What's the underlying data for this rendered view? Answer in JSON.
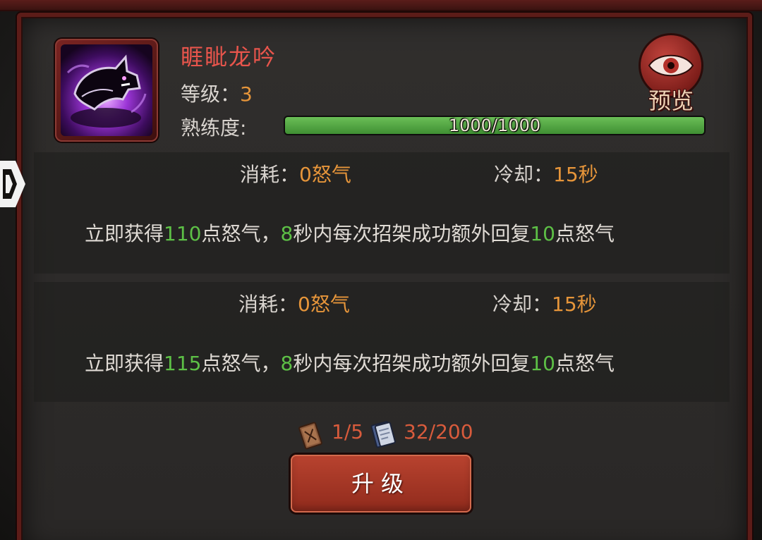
{
  "skill": {
    "name": "睚眦龙吟",
    "level_label": "等级：",
    "level_value": "3",
    "mastery_label": "熟练度:",
    "mastery_text": "1000/1000",
    "mastery_fraction": 1.0,
    "icon": "wolf-skill-icon"
  },
  "preview": {
    "label": "预览",
    "icon": "eye-icon"
  },
  "tiers": [
    {
      "cost_label": "消耗：",
      "cost_value": "0怒气",
      "cooldown_label": "冷却：",
      "cooldown_value": "15秒",
      "desc_parts": [
        "立即获得",
        "110",
        "点怒气，",
        "8",
        "秒内每次招架成功额外回复",
        "10",
        "点怒气"
      ]
    },
    {
      "cost_label": "消耗：",
      "cost_value": "0怒气",
      "cooldown_label": "冷却：",
      "cooldown_value": "15秒",
      "desc_parts": [
        "立即获得",
        "115",
        "点怒气，",
        "8",
        "秒内每次招架成功额外回复",
        "10",
        "点怒气"
      ]
    }
  ],
  "materials": [
    {
      "icon": "skill-book-icon",
      "count": "1/5"
    },
    {
      "icon": "scroll-icon",
      "count": "32/200"
    }
  ],
  "upgrade_label": "升级",
  "colors": {
    "name": "#e8554c",
    "value_orange": "#e6953a",
    "number_green": "#5dc046",
    "material_red": "#d85b3c",
    "button_red": "#b9432f"
  }
}
